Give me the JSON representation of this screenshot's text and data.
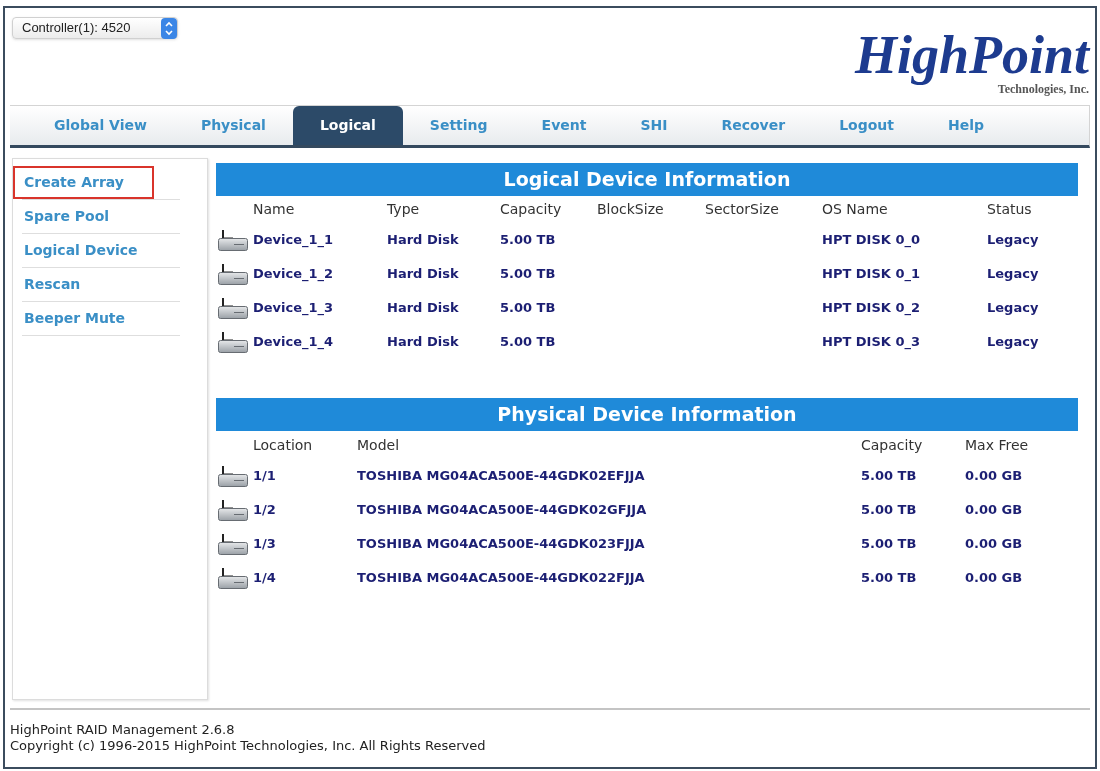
{
  "controller_select": {
    "value": "Controller(1): 4520"
  },
  "logo": {
    "name": "HighPoint",
    "tagline": "Technologies, Inc."
  },
  "tabs": [
    {
      "label": "Global View",
      "selected": false
    },
    {
      "label": "Physical",
      "selected": false
    },
    {
      "label": "Logical",
      "selected": true
    },
    {
      "label": "Setting",
      "selected": false
    },
    {
      "label": "Event",
      "selected": false
    },
    {
      "label": "SHI",
      "selected": false
    },
    {
      "label": "Recover",
      "selected": false
    },
    {
      "label": "Logout",
      "selected": false
    },
    {
      "label": "Help",
      "selected": false
    }
  ],
  "sidebar": {
    "items": [
      {
        "label": "Create Array",
        "selected": true
      },
      {
        "label": "Spare Pool",
        "selected": false
      },
      {
        "label": "Logical Device",
        "selected": false
      },
      {
        "label": "Rescan",
        "selected": false
      },
      {
        "label": "Beeper Mute",
        "selected": false
      }
    ]
  },
  "logical_device_information": {
    "title": "Logical Device Information",
    "columns": [
      "Name",
      "Type",
      "Capacity",
      "BlockSize",
      "SectorSize",
      "OS Name",
      "Status"
    ],
    "rows": [
      {
        "name": "Device_1_1",
        "type": "Hard Disk",
        "capacity": "5.00 TB",
        "os_name": "HPT DISK 0_0",
        "status": "Legacy"
      },
      {
        "name": "Device_1_2",
        "type": "Hard Disk",
        "capacity": "5.00 TB",
        "os_name": "HPT DISK 0_1",
        "status": "Legacy"
      },
      {
        "name": "Device_1_3",
        "type": "Hard Disk",
        "capacity": "5.00 TB",
        "os_name": "HPT DISK 0_2",
        "status": "Legacy"
      },
      {
        "name": "Device_1_4",
        "type": "Hard Disk",
        "capacity": "5.00 TB",
        "os_name": "HPT DISK 0_3",
        "status": "Legacy"
      }
    ]
  },
  "physical_device_information": {
    "title": "Physical Device Information",
    "columns": [
      "Location",
      "Model",
      "Capacity",
      "Max Free"
    ],
    "rows": [
      {
        "location": "1/1",
        "model": "TOSHIBA MG04ACA500E-44GDK02EFJJA",
        "capacity": "5.00 TB",
        "max_free": "0.00 GB"
      },
      {
        "location": "1/2",
        "model": "TOSHIBA MG04ACA500E-44GDK02GFJJA",
        "capacity": "5.00 TB",
        "max_free": "0.00 GB"
      },
      {
        "location": "1/3",
        "model": "TOSHIBA MG04ACA500E-44GDK023FJJA",
        "capacity": "5.00 TB",
        "max_free": "0.00 GB"
      },
      {
        "location": "1/4",
        "model": "TOSHIBA MG04ACA500E-44GDK022FJJA",
        "capacity": "5.00 TB",
        "max_free": "0.00 GB"
      }
    ]
  },
  "footer": {
    "lines": [
      "HighPoint RAID Management 2.6.8",
      "Copyright (c) 1996-2015 HighPoint Technologies, Inc. All Rights Reserved"
    ]
  }
}
